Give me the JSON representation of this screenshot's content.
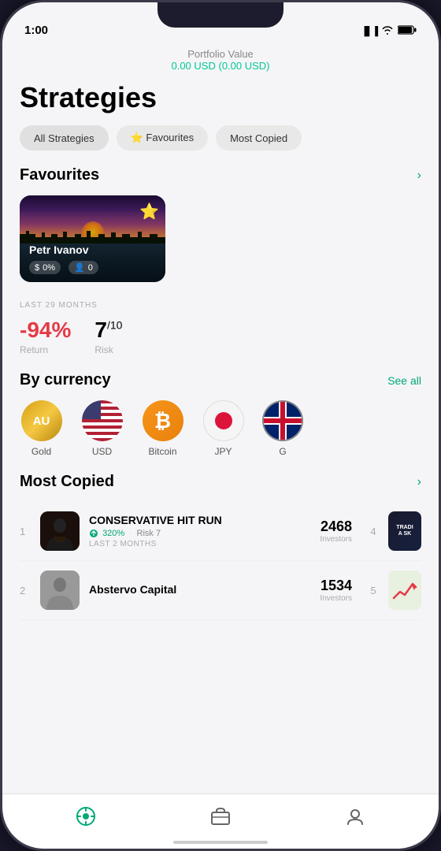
{
  "status_bar": {
    "time": "1:00",
    "signal": "▐▐▐",
    "wifi": "wifi",
    "battery": "🔋"
  },
  "portfolio": {
    "label": "Portfolio Value",
    "value": "0.00 USD",
    "change": "(0.00 USD)"
  },
  "page_title": "Strategies",
  "filters": [
    {
      "id": "all",
      "label": "All Strategies"
    },
    {
      "id": "favourites",
      "label": "⭐ Favourites"
    },
    {
      "id": "most_copied",
      "label": "Most Copied"
    }
  ],
  "favourites_section": {
    "title": "Favourites",
    "arrow": "›",
    "cards": [
      {
        "name": "Petr Ivanov",
        "return_pct": "0%",
        "followers": "0",
        "star": "⭐"
      }
    ]
  },
  "performance": {
    "period": "LAST 29 MONTHS",
    "return_value": "-94%",
    "return_label": "Return",
    "risk_value": "7",
    "risk_suffix": "/10",
    "risk_label": "Risk"
  },
  "currency_section": {
    "title": "By currency",
    "see_all": "See all",
    "currencies": [
      {
        "id": "gold",
        "label": "Gold",
        "symbol": "AU"
      },
      {
        "id": "usd",
        "label": "USD",
        "symbol": "🇺🇸"
      },
      {
        "id": "bitcoin",
        "label": "Bitcoin",
        "symbol": "₿"
      },
      {
        "id": "jpy",
        "label": "JPY",
        "symbol": "🔴"
      },
      {
        "id": "gbp",
        "label": "G",
        "symbol": "🇬🇧"
      }
    ]
  },
  "most_copied_section": {
    "title": "Most Copied",
    "arrow": "›",
    "items": [
      {
        "rank": "1",
        "name": "CONSERVATIVE HIT RUN",
        "return_pct": "320%",
        "risk": "Risk 7",
        "period": "LAST 2 MONTHS",
        "count": "2468",
        "count_label": "Investors",
        "rank_badge": "4"
      },
      {
        "rank": "2",
        "name": "Abstervo Capital",
        "return_pct": "",
        "risk": "",
        "period": "",
        "count": "1534",
        "count_label": "Investors",
        "rank_badge": "5"
      }
    ]
  },
  "bottom_nav": {
    "items": [
      {
        "id": "home",
        "label": "",
        "active": true
      },
      {
        "id": "portfolio",
        "label": "",
        "active": false
      },
      {
        "id": "profile",
        "label": "",
        "active": false
      }
    ]
  }
}
